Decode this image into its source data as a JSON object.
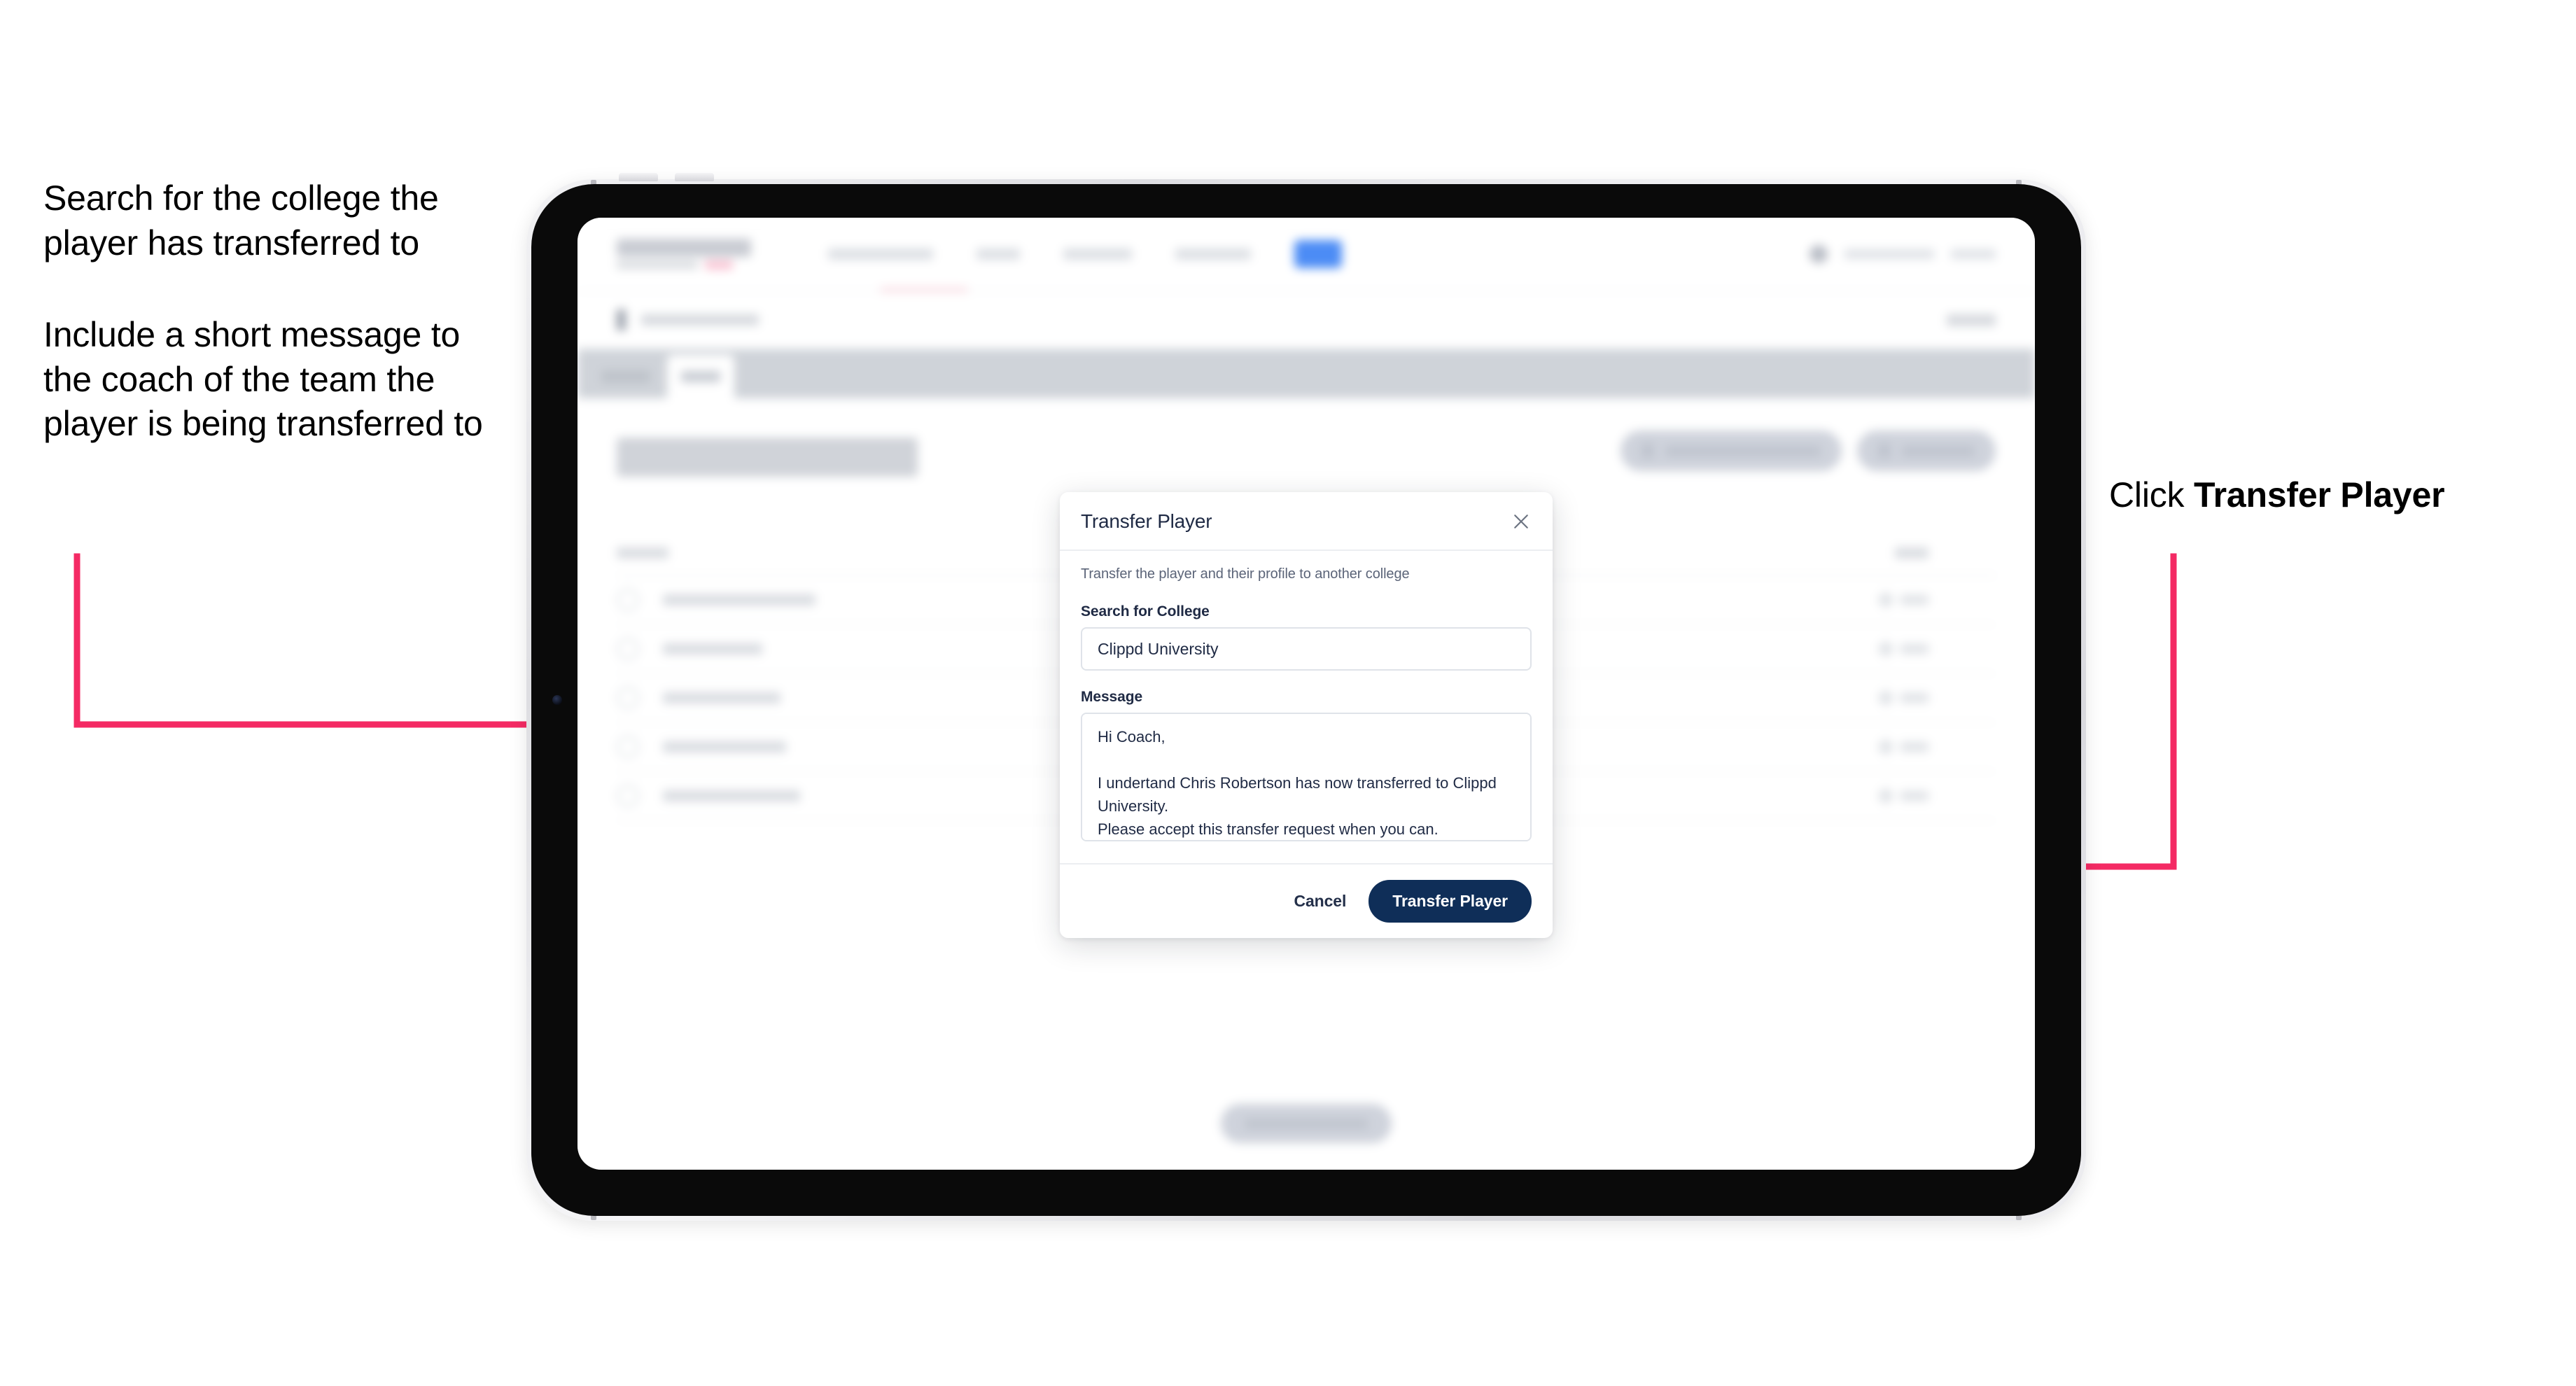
{
  "annotations": {
    "left": [
      "Search for the college the player has transferred to",
      "Include a short message to the coach of the team the player is being transferred to"
    ],
    "right_prefix": "Click ",
    "right_bold": "Transfer Player"
  },
  "colors": {
    "arrow_pink": "#F42A64",
    "primary_navy": "#0f2e58",
    "nav_active_blue": "#4c8cf5",
    "text_dark": "#1f2a44"
  },
  "app": {
    "logo": "SCOREBOARD",
    "nav_items": [
      "TOURNAMENTS",
      "TEAMS",
      "SCHEDULE",
      "ANALYTICS",
      "ROSTER"
    ],
    "breadcrumb": "Scoreboard",
    "tabs": [
      "Details",
      "Roster"
    ],
    "page_title": "Update Roster",
    "table_headers": [
      "Name",
      "Edit"
    ],
    "players": [
      "Chris Robertson",
      "Ian Winter",
      "John Taylor",
      "Lewis Baxter",
      "Nathan Holmes"
    ],
    "actions": [
      "Request Player Transfer",
      "Add Player"
    ],
    "bottom_cta": "Save And Continue"
  },
  "modal": {
    "title": "Transfer Player",
    "close_icon": "close-icon",
    "description": "Transfer the player and their profile to another college",
    "college_label": "Search for College",
    "college_value": "Clippd University",
    "college_placeholder": "Search for College",
    "message_label": "Message",
    "message_value": "Hi Coach,\n\nI undertand Chris Robertson has now transferred to Clippd University.\nPlease accept this transfer request when you can.",
    "message_placeholder": "Message",
    "cancel_label": "Cancel",
    "submit_label": "Transfer Player"
  }
}
